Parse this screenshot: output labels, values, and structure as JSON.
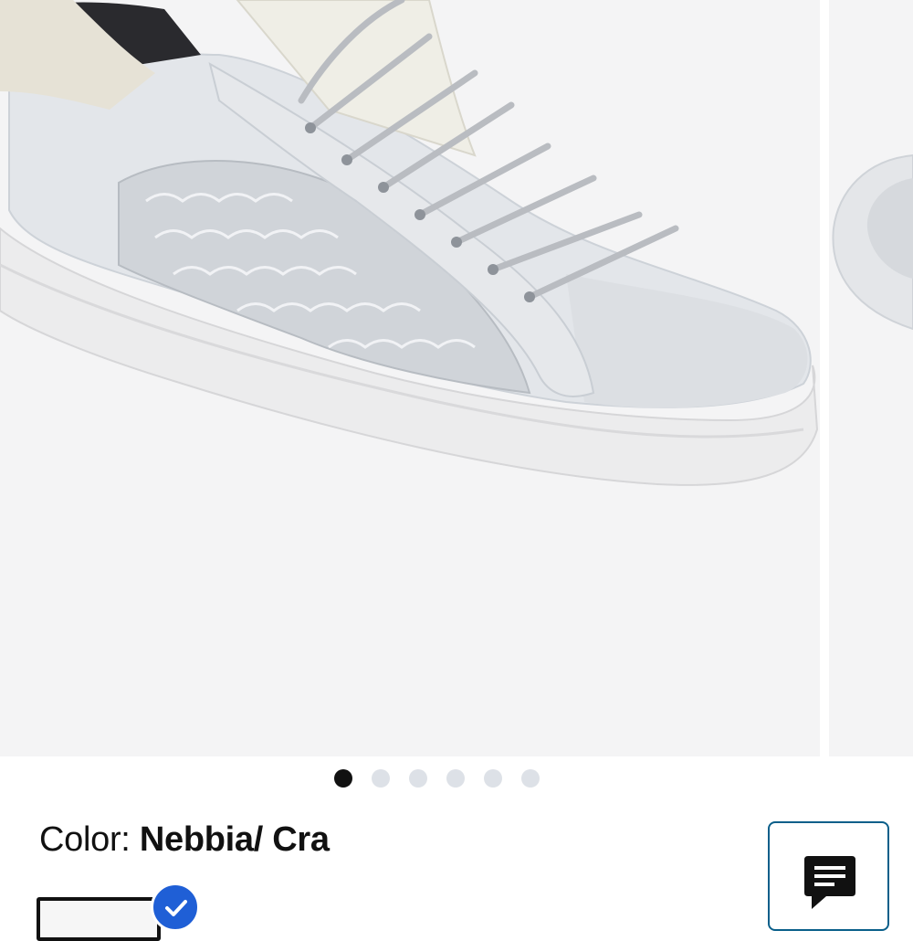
{
  "gallery": {
    "pagination": {
      "total": 6,
      "active_index": 0
    }
  },
  "product": {
    "color_label": "Color:",
    "color_value": "Nebbia/ Cra"
  },
  "icons": {
    "swatch_selected": "check-icon",
    "chat": "chat-icon"
  },
  "colors": {
    "accent_blue": "#1f5fd6",
    "chat_border": "#0a5f8a",
    "image_bg": "#f4f4f5",
    "dot_active": "#111111",
    "dot_inactive": "#dde1e7"
  }
}
